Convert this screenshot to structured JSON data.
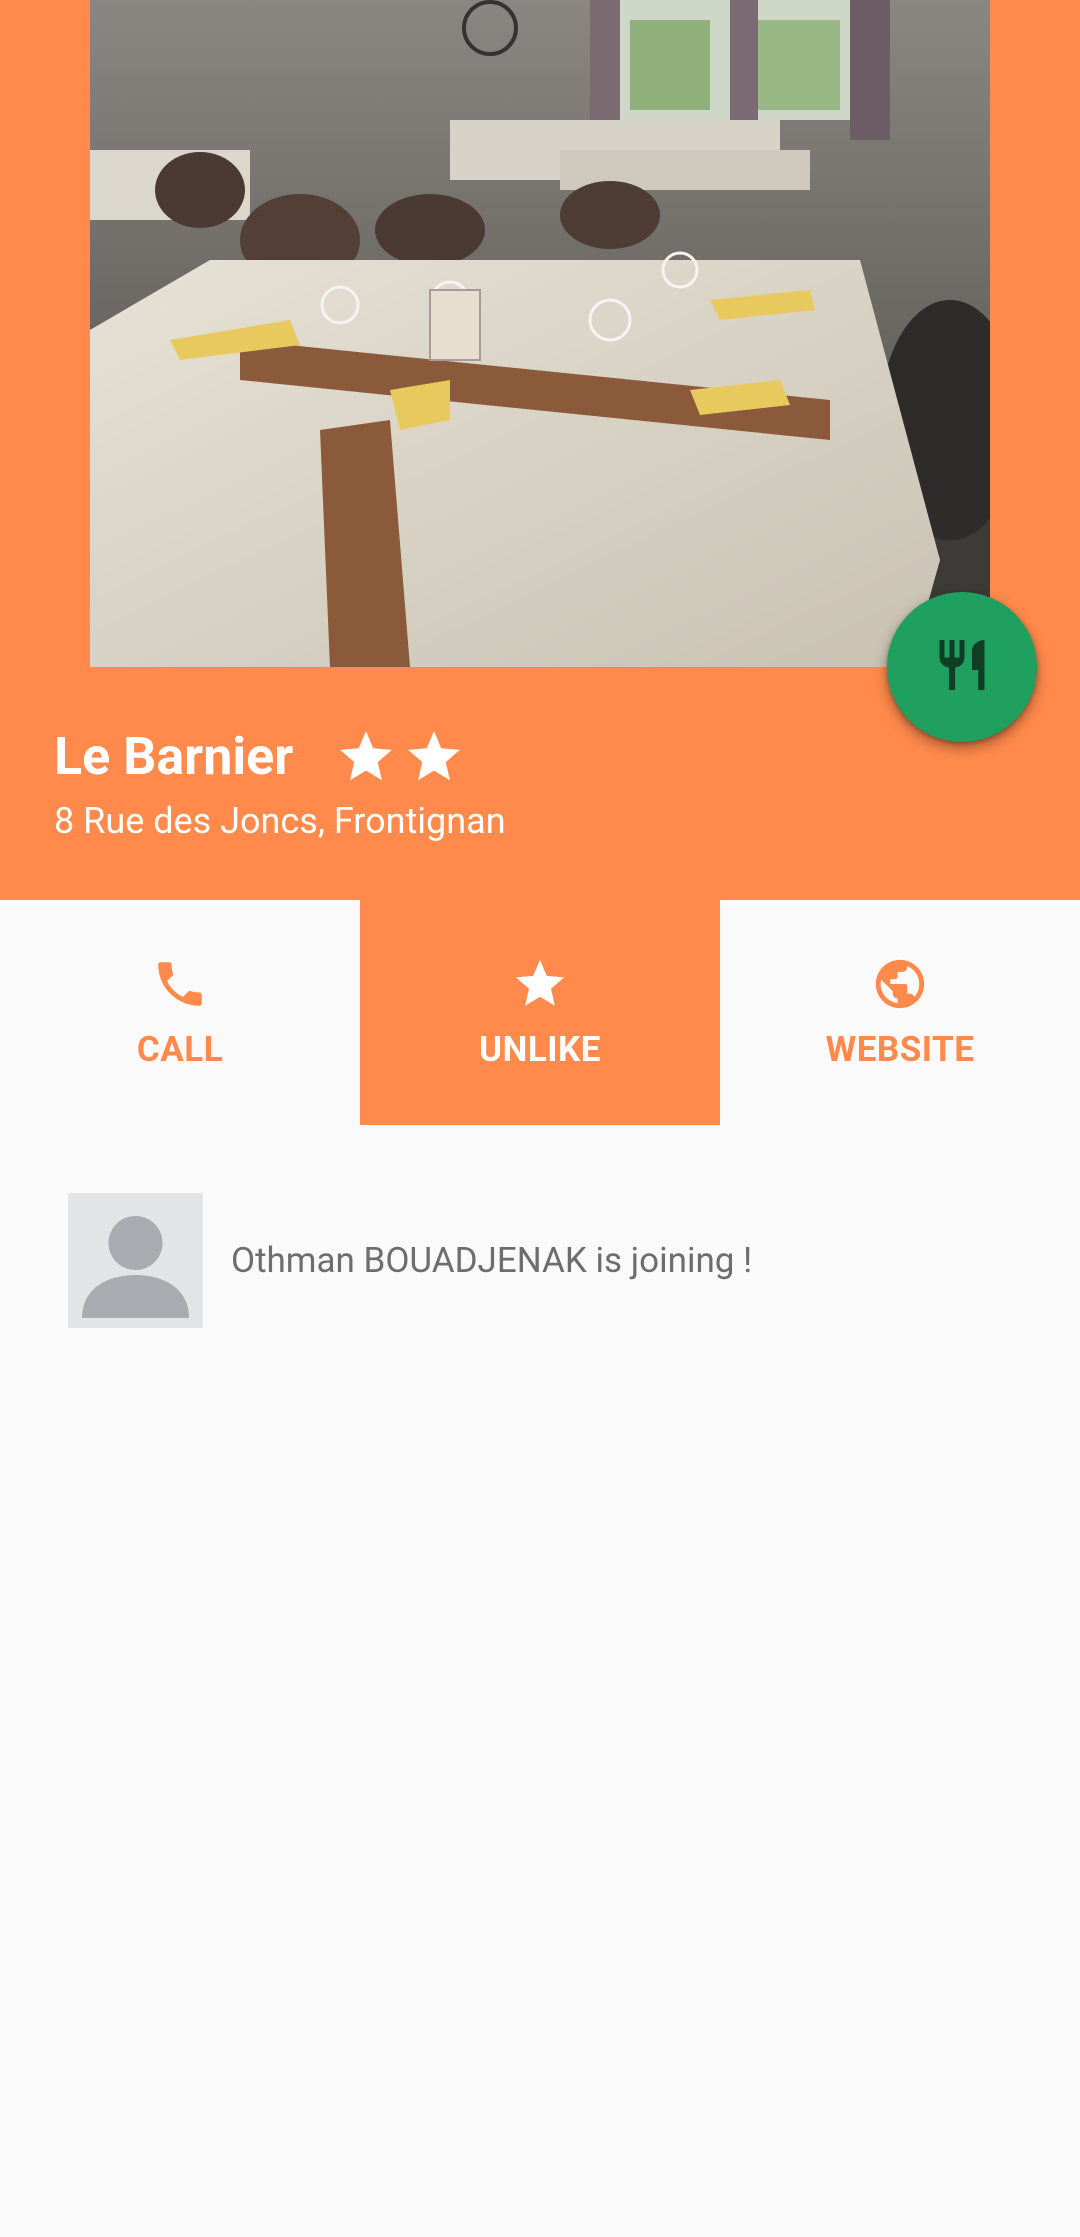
{
  "restaurant": {
    "name": "Le Barnier",
    "rating_stars": 2,
    "address": "8 Rue des Joncs, Frontignan"
  },
  "photo": {
    "description_icon": "restaurant-photo"
  },
  "fab": {
    "icon": "fork-knife-icon",
    "color": "#1fa05f"
  },
  "actions": [
    {
      "label": "CALL",
      "icon": "phone-icon",
      "active": false
    },
    {
      "label": "UNLIKE",
      "icon": "star-icon",
      "active": true
    },
    {
      "label": "WEBSITE",
      "icon": "globe-icon",
      "active": false
    }
  ],
  "attendees": [
    {
      "text": "Othman BOUADJENAK is joining !",
      "avatar": "default-avatar-icon"
    }
  ],
  "colors": {
    "accent": "#ff8a4c",
    "background": "#fafafa",
    "fab": "#1fa05f"
  }
}
